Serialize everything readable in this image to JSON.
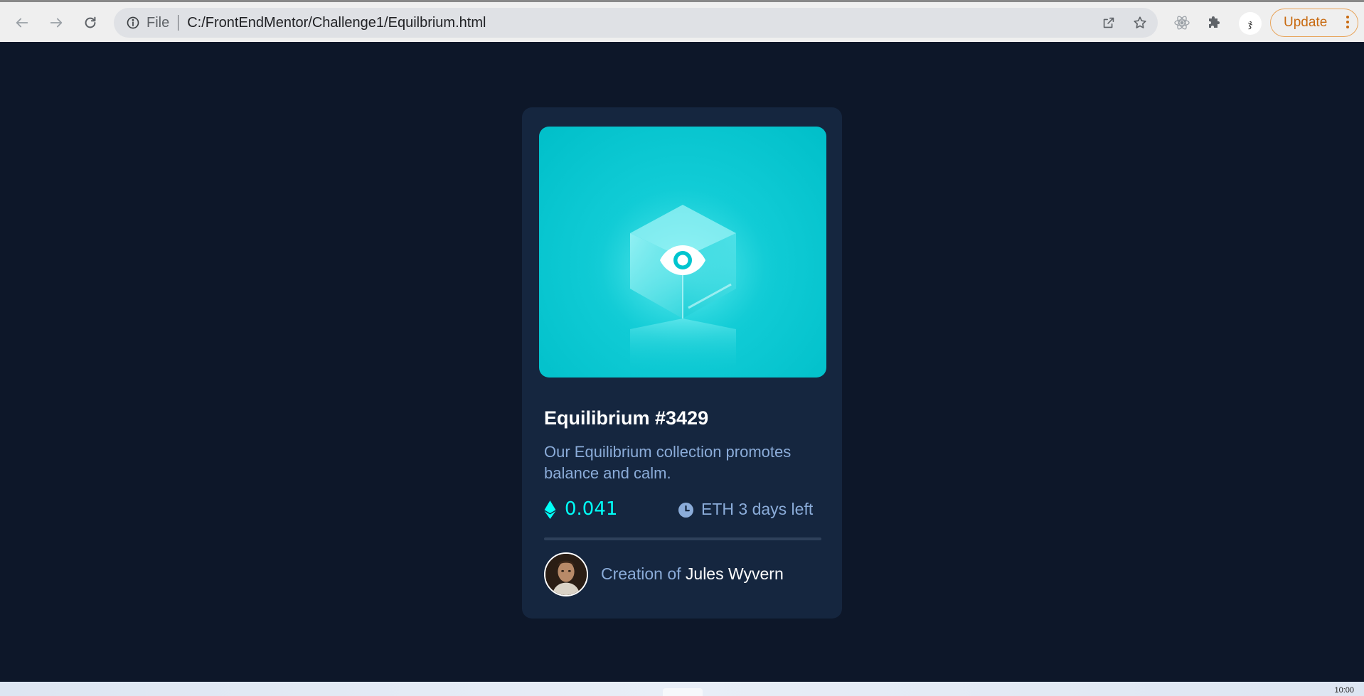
{
  "browser": {
    "scheme_label": "File",
    "url": "C:/FrontEndMentor/Challenge1/Equilbrium.html",
    "update_label": "Update",
    "profile_initial": "ჯ"
  },
  "card": {
    "title": "Equilibrium #3429",
    "description": "Our Equilibrium collection promotes balance and calm.",
    "price": "0.041",
    "time_left": "ETH 3 days left",
    "creator_prefix": "Creation of",
    "creator_name": "Jules Wyvern"
  },
  "taskbar": {
    "time": "10:00"
  },
  "colors": {
    "page_bg": "#0d1729",
    "card_bg": "#15263f",
    "cyan": "#00fff8",
    "soft_blue": "#8bacd9",
    "white": "#ffffff",
    "line": "#2e405a"
  },
  "icons": {
    "back": "arrow-left-icon",
    "forward": "arrow-right-icon",
    "reload": "reload-icon",
    "info": "info-icon",
    "share": "share-icon",
    "star": "star-icon",
    "react": "react-devtools-icon",
    "puzzle": "puzzle-icon",
    "eye": "eye-icon",
    "ethereum": "ethereum-icon",
    "clock": "clock-icon"
  }
}
